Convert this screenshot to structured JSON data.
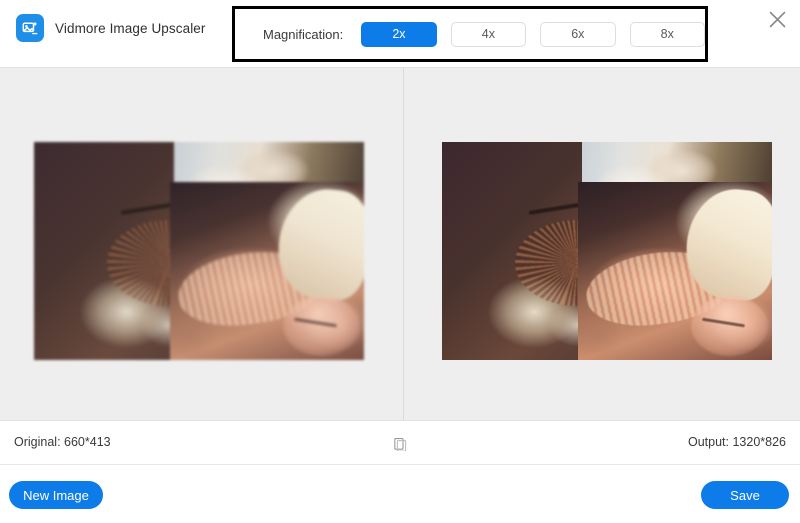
{
  "app": {
    "title": "Vidmore Image Upscaler",
    "logo_icon": "image-photo-icon",
    "accent_color": "#0d7ce8",
    "background_color": "#eeeeee",
    "highlight_box_color": "#000000"
  },
  "header": {
    "close_icon": "close-x-icon",
    "magnification": {
      "label": "Magnification:",
      "selected": "2x",
      "options": [
        {
          "label": "2x",
          "active": true
        },
        {
          "label": "4x",
          "active": false
        },
        {
          "label": "6x",
          "active": false
        },
        {
          "label": "8x",
          "active": false
        }
      ]
    }
  },
  "preview": {
    "left_pane_name": "original-preview",
    "right_pane_name": "upscaled-preview",
    "image_subject": "photo collage: bicycle with white flowers and woman wearing a wide-brim sun hat"
  },
  "statusbar": {
    "original": "Original: 660*413",
    "output": "Output: 1320*826",
    "compare_icon": "compare-square-icon"
  },
  "footer": {
    "new_image_label": "New Image",
    "save_label": "Save"
  }
}
